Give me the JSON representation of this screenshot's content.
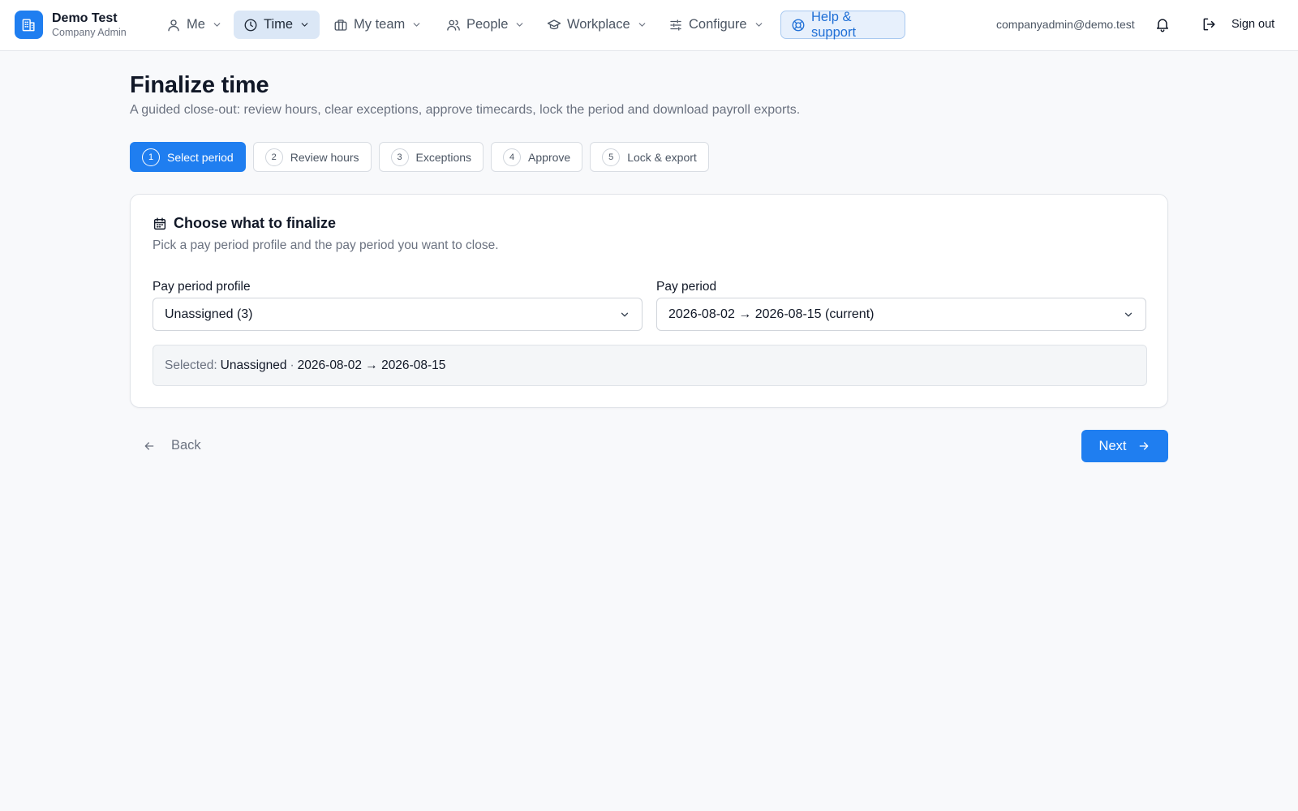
{
  "brand": {
    "name": "Demo Test",
    "role": "Company Admin",
    "icon": "building-icon",
    "color": "#1f7ef0"
  },
  "nav": {
    "items": [
      {
        "label": "Me",
        "icon": "user-icon"
      },
      {
        "label": "Time",
        "icon": "clock-icon",
        "active": true
      },
      {
        "label": "My team",
        "icon": "briefcase-icon"
      },
      {
        "label": "People",
        "icon": "users-icon"
      },
      {
        "label": "Workplace",
        "icon": "graduation-cap-icon"
      },
      {
        "label": "Configure",
        "icon": "sliders-icon"
      }
    ],
    "help": {
      "label": "Help & support",
      "icon": "lifebuoy-icon"
    },
    "email": "companyadmin@demo.test",
    "signout": "Sign out"
  },
  "page": {
    "title": "Finalize time",
    "subtitle": "A guided close-out: review hours, clear exceptions, approve timecards, lock the period and download payroll exports."
  },
  "steps": [
    {
      "num": "1",
      "label": "Select period",
      "active": true
    },
    {
      "num": "2",
      "label": "Review hours"
    },
    {
      "num": "3",
      "label": "Exceptions"
    },
    {
      "num": "4",
      "label": "Approve"
    },
    {
      "num": "5",
      "label": "Lock & export"
    }
  ],
  "card": {
    "title": "Choose what to finalize",
    "description": "Pick a pay period profile and the pay period you want to close.",
    "icon": "calendar-icon",
    "profile": {
      "label": "Pay period profile",
      "value": "Unassigned (3)"
    },
    "period": {
      "label": "Pay period",
      "value": "2026-08-02 → 2026-08-15 (current)"
    },
    "summary": {
      "prefix": "Selected:",
      "profile": "Unassigned",
      "separator": "·",
      "period": "2026-08-02 → 2026-08-15"
    }
  },
  "actions": {
    "back": "Back",
    "next": "Next"
  },
  "colors": {
    "accent": "#1f7ef0",
    "active_nav_bg": "#dbe7f6",
    "help_bg": "#e7f0fc",
    "page_bg": "#f8f9fb"
  }
}
